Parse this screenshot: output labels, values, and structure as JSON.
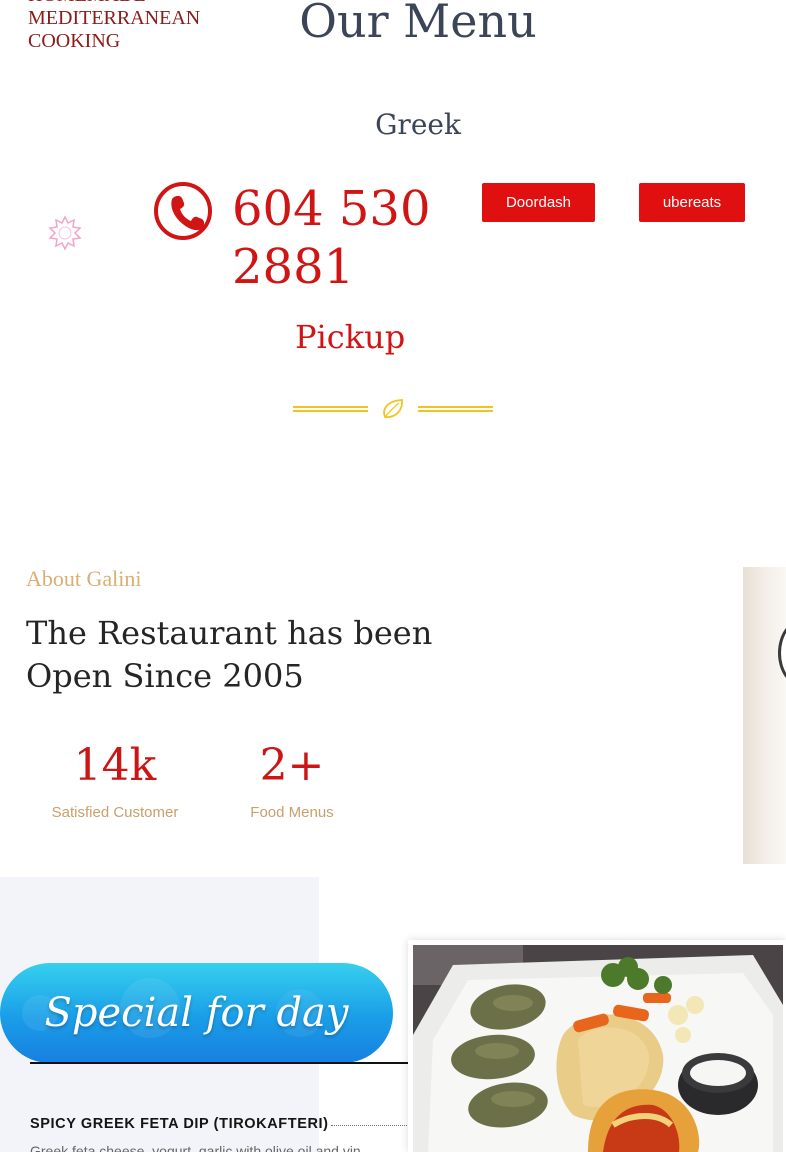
{
  "header": {
    "tagline": "HOMEMADE MEDITERRANEAN COOKING",
    "title": "Our Menu",
    "subtitle": "Greek"
  },
  "contact": {
    "phone": "604 530 2881",
    "pickup_label": "Pickup",
    "buttons": [
      {
        "label": "Doordash"
      },
      {
        "label": "ubereats"
      }
    ]
  },
  "about": {
    "label": "About Galini",
    "heading": "The Restaurant has been Open Since 2005",
    "stats": [
      {
        "value": "14k",
        "label": "Satisfied Customer"
      },
      {
        "value": "2+",
        "label": "Food Menus"
      }
    ]
  },
  "special": {
    "title": "Special for day",
    "items": [
      {
        "name": "SPICY GREEK FETA DIP (TIROKAFTERI)",
        "description": "Greek feta cheese, yogurt, garlic with olive oil and vin"
      }
    ]
  },
  "colors": {
    "accent_red": "#e01010",
    "gold": "#d8b073",
    "heading_slate": "#3c4458",
    "special_blue": "#1a9de8"
  },
  "icons": [
    "star-badge-icon",
    "phone-icon",
    "leaf-icon"
  ]
}
